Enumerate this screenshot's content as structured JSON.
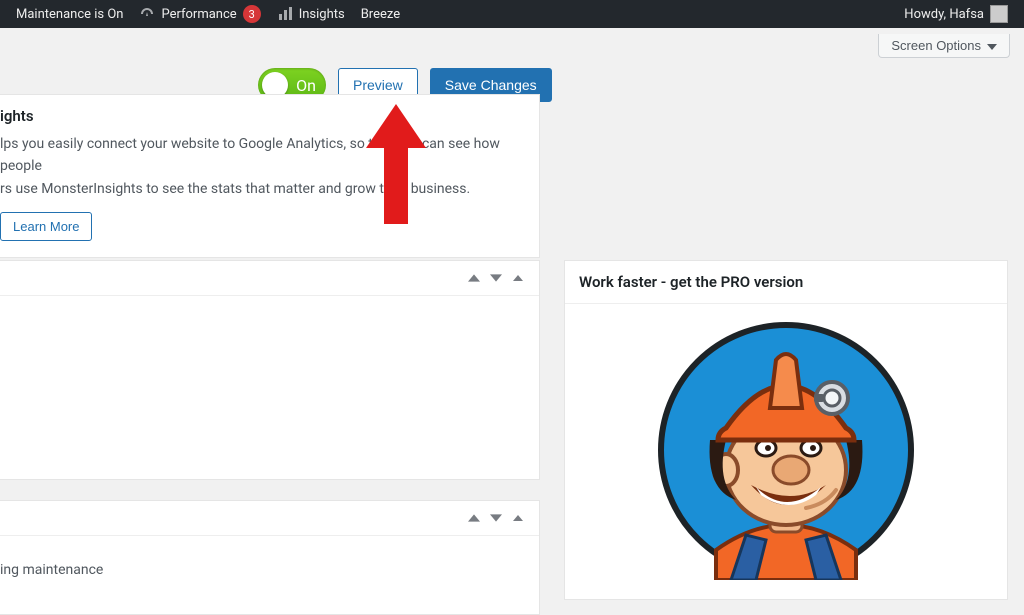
{
  "adminbar": {
    "maintenance_label": "Maintenance is On",
    "performance_label": "Performance",
    "performance_badge": "3",
    "insights_label": "Insights",
    "breeze_label": "Breeze",
    "howdy": "Howdy, Hafsa"
  },
  "screen_options": {
    "label": "Screen Options"
  },
  "actions": {
    "toggle_label": "On",
    "preview_label": "Preview",
    "save_label": "Save Changes"
  },
  "insights": {
    "title": "ights",
    "desc_line1": "lps you easily connect your website to Google Analytics, so that you can see how people",
    "desc_line2": "rs use MonsterInsights to see the stats that matter and grow their business.",
    "learn_more": "Learn More"
  },
  "collapse2": {
    "body_text": "ing maintenance"
  },
  "right_panel": {
    "title": "Work faster - get the PRO version"
  }
}
